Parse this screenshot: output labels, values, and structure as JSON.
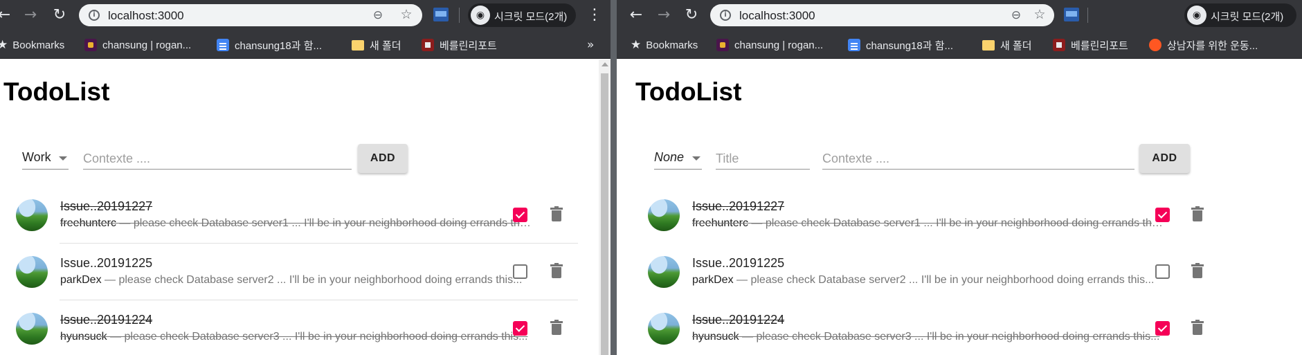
{
  "browser": {
    "url": "localhost:3000",
    "incognito_label": "시크릿 모드(2개)",
    "more_bookmarks": "»"
  },
  "icons": {
    "back": "←",
    "forward": "→",
    "reload": "↻",
    "info": "i",
    "zoom": "⊖",
    "star": "☆",
    "incognito": "◉",
    "menu": "⋮",
    "bookmark_star": "★"
  },
  "left_bookmarks": [
    "Bookmarks",
    "chansung | rogan...",
    "chansung18과 함...",
    "새 폴더",
    "베를린리포트"
  ],
  "right_bookmarks": [
    "Bookmarks",
    "chansung | rogan...",
    "chansung18과 함...",
    "새 폴더",
    "베를린리포트",
    "상남자를 위한 운동..."
  ],
  "app": {
    "title": "TodoList",
    "add_label": "ADD",
    "title_placeholder": "Title",
    "context_placeholder": "Contexte ....",
    "left_category": "Work",
    "right_category": "None"
  },
  "todos": [
    {
      "title": "Issue..20191227",
      "author": "freehunterc",
      "text": " — please check Database server1 ... I'll be in your neighborhood doing errands this...",
      "done": true
    },
    {
      "title": "Issue..20191225",
      "author": "parkDex",
      "text": " — please check Database server2 ... I'll be in your neighborhood doing errands this...",
      "done": false
    },
    {
      "title": "Issue..20191224",
      "author": "hyunsuck",
      "text": " — please check Database server3 ... I'll be in your neighborhood doing errands this...",
      "done": true
    }
  ],
  "colors": {
    "checked": "#f50057",
    "chrome_dark": "#35363a"
  }
}
